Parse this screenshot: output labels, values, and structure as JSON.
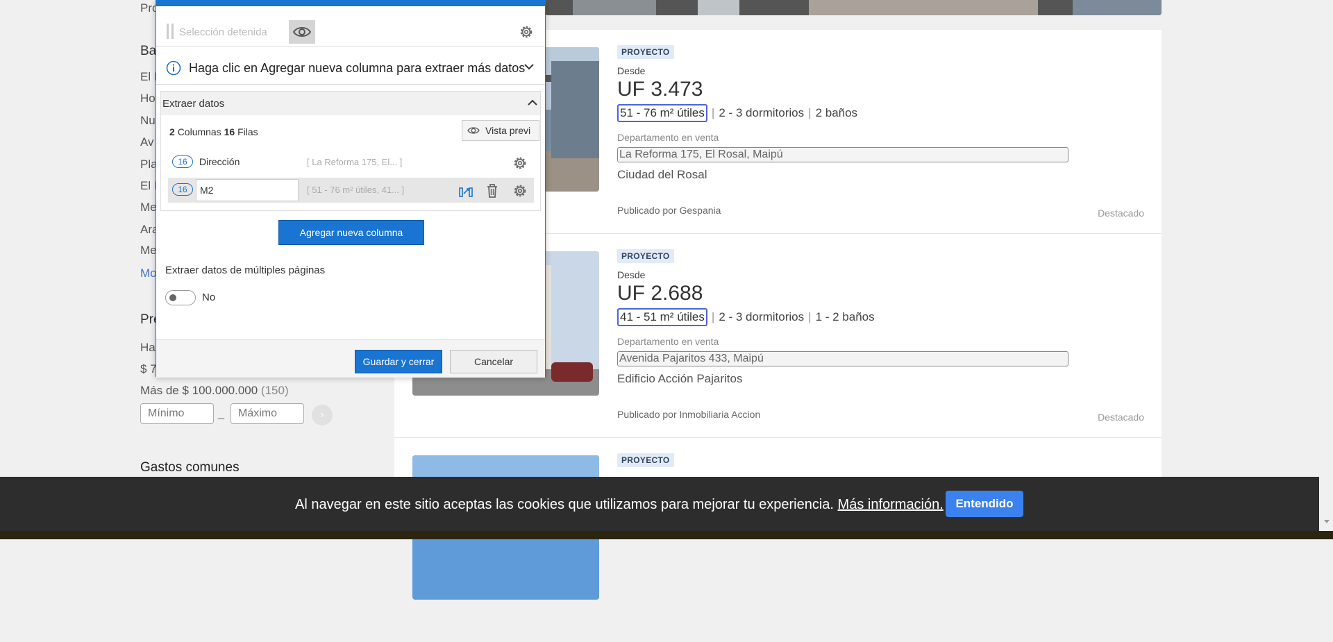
{
  "sidebar": {
    "top_label": "Pro",
    "section_barrio": {
      "title": "Ba",
      "items": [
        "El R",
        "Ho",
        "Nu",
        "Av",
        "Pla",
        "El I",
        "Me",
        "Ara",
        "Me"
      ],
      "more_link": "Mo"
    },
    "section_precio": {
      "title": "Pre",
      "items": [
        "Ha",
        "$ 7"
      ],
      "more_item": "Más de $ 100.000.000",
      "more_item_count": "(150)",
      "min_placeholder": "Mínimo",
      "max_placeholder": "Máximo",
      "range_separator": "_",
      "go_icon": "chevron-right-icon"
    },
    "section_gastos": {
      "title": "Gastos comunes"
    }
  },
  "listings": [
    {
      "badge": "PROYECTO",
      "desde": "Desde",
      "price": "UF 3.473",
      "area": "51 - 76 m² útiles",
      "bedrooms": "2 - 3 dormitorios",
      "bathrooms": "2 baños",
      "type": "Departamento en venta",
      "address": "La Reforma 175, El Rosal, Maipú",
      "project": "Ciudad del Rosal",
      "publisher": "Publicado por Gespania",
      "tag": "Destacado"
    },
    {
      "badge": "PROYECTO",
      "desde": "Desde",
      "price": "UF 2.688",
      "area": "41 - 51 m² útiles",
      "bedrooms": "2 - 3 dormitorios",
      "bathrooms": "1 - 2 baños",
      "type": "Departamento en venta",
      "address": "Avenida Pajaritos 433, Maipú",
      "project": "Edificio Acción Pajaritos",
      "publisher": "Publicado por Inmobiliaria Accion",
      "tag": "Destacado"
    },
    {
      "badge": "PROYECTO"
    }
  ],
  "extension": {
    "status": "Selección detenida",
    "icons": {
      "pause": "pause-icon",
      "preview": "eye-icon",
      "settings": "gear-icon",
      "info": "info-icon",
      "expand": "chevron-down-icon",
      "collapse": "chevron-up-icon",
      "edit": "edit-selector-icon",
      "delete": "trash-icon"
    },
    "tip": "Haga clic en Agregar nueva columna para extraer más datos",
    "extract_section_title": "Extraer datos",
    "counts": {
      "columns": "2",
      "columns_label": "Columnas",
      "rows": "16",
      "rows_label": "Filas"
    },
    "preview_button": "Vista previ",
    "columns": [
      {
        "count": "16",
        "name": "Dirección",
        "sample": "[ La Reforma 175, El...   ]"
      },
      {
        "count": "16",
        "name": "M2",
        "sample": "[ 51 - 76 m² útiles, 41...  ]"
      }
    ],
    "add_column_button": "Agregar nueva columna",
    "multi_page_title": "Extraer datos de múltiples páginas",
    "multi_page_state": "No",
    "save_button": "Guardar y cerrar",
    "cancel_button": "Cancelar"
  },
  "cookie_bar": {
    "text": "Al navegar en este sitio aceptas las cookies que utilizamos para mejorar tu experiencia.",
    "link": "Más información.",
    "button": "Entendido"
  },
  "colors": {
    "accent": "#1a74d1",
    "badge_bg": "#e1ebf8",
    "cookie_bg": "#2d2d2d",
    "cookie_button": "#3b82f0",
    "highlight_border": "#4d64d6"
  }
}
